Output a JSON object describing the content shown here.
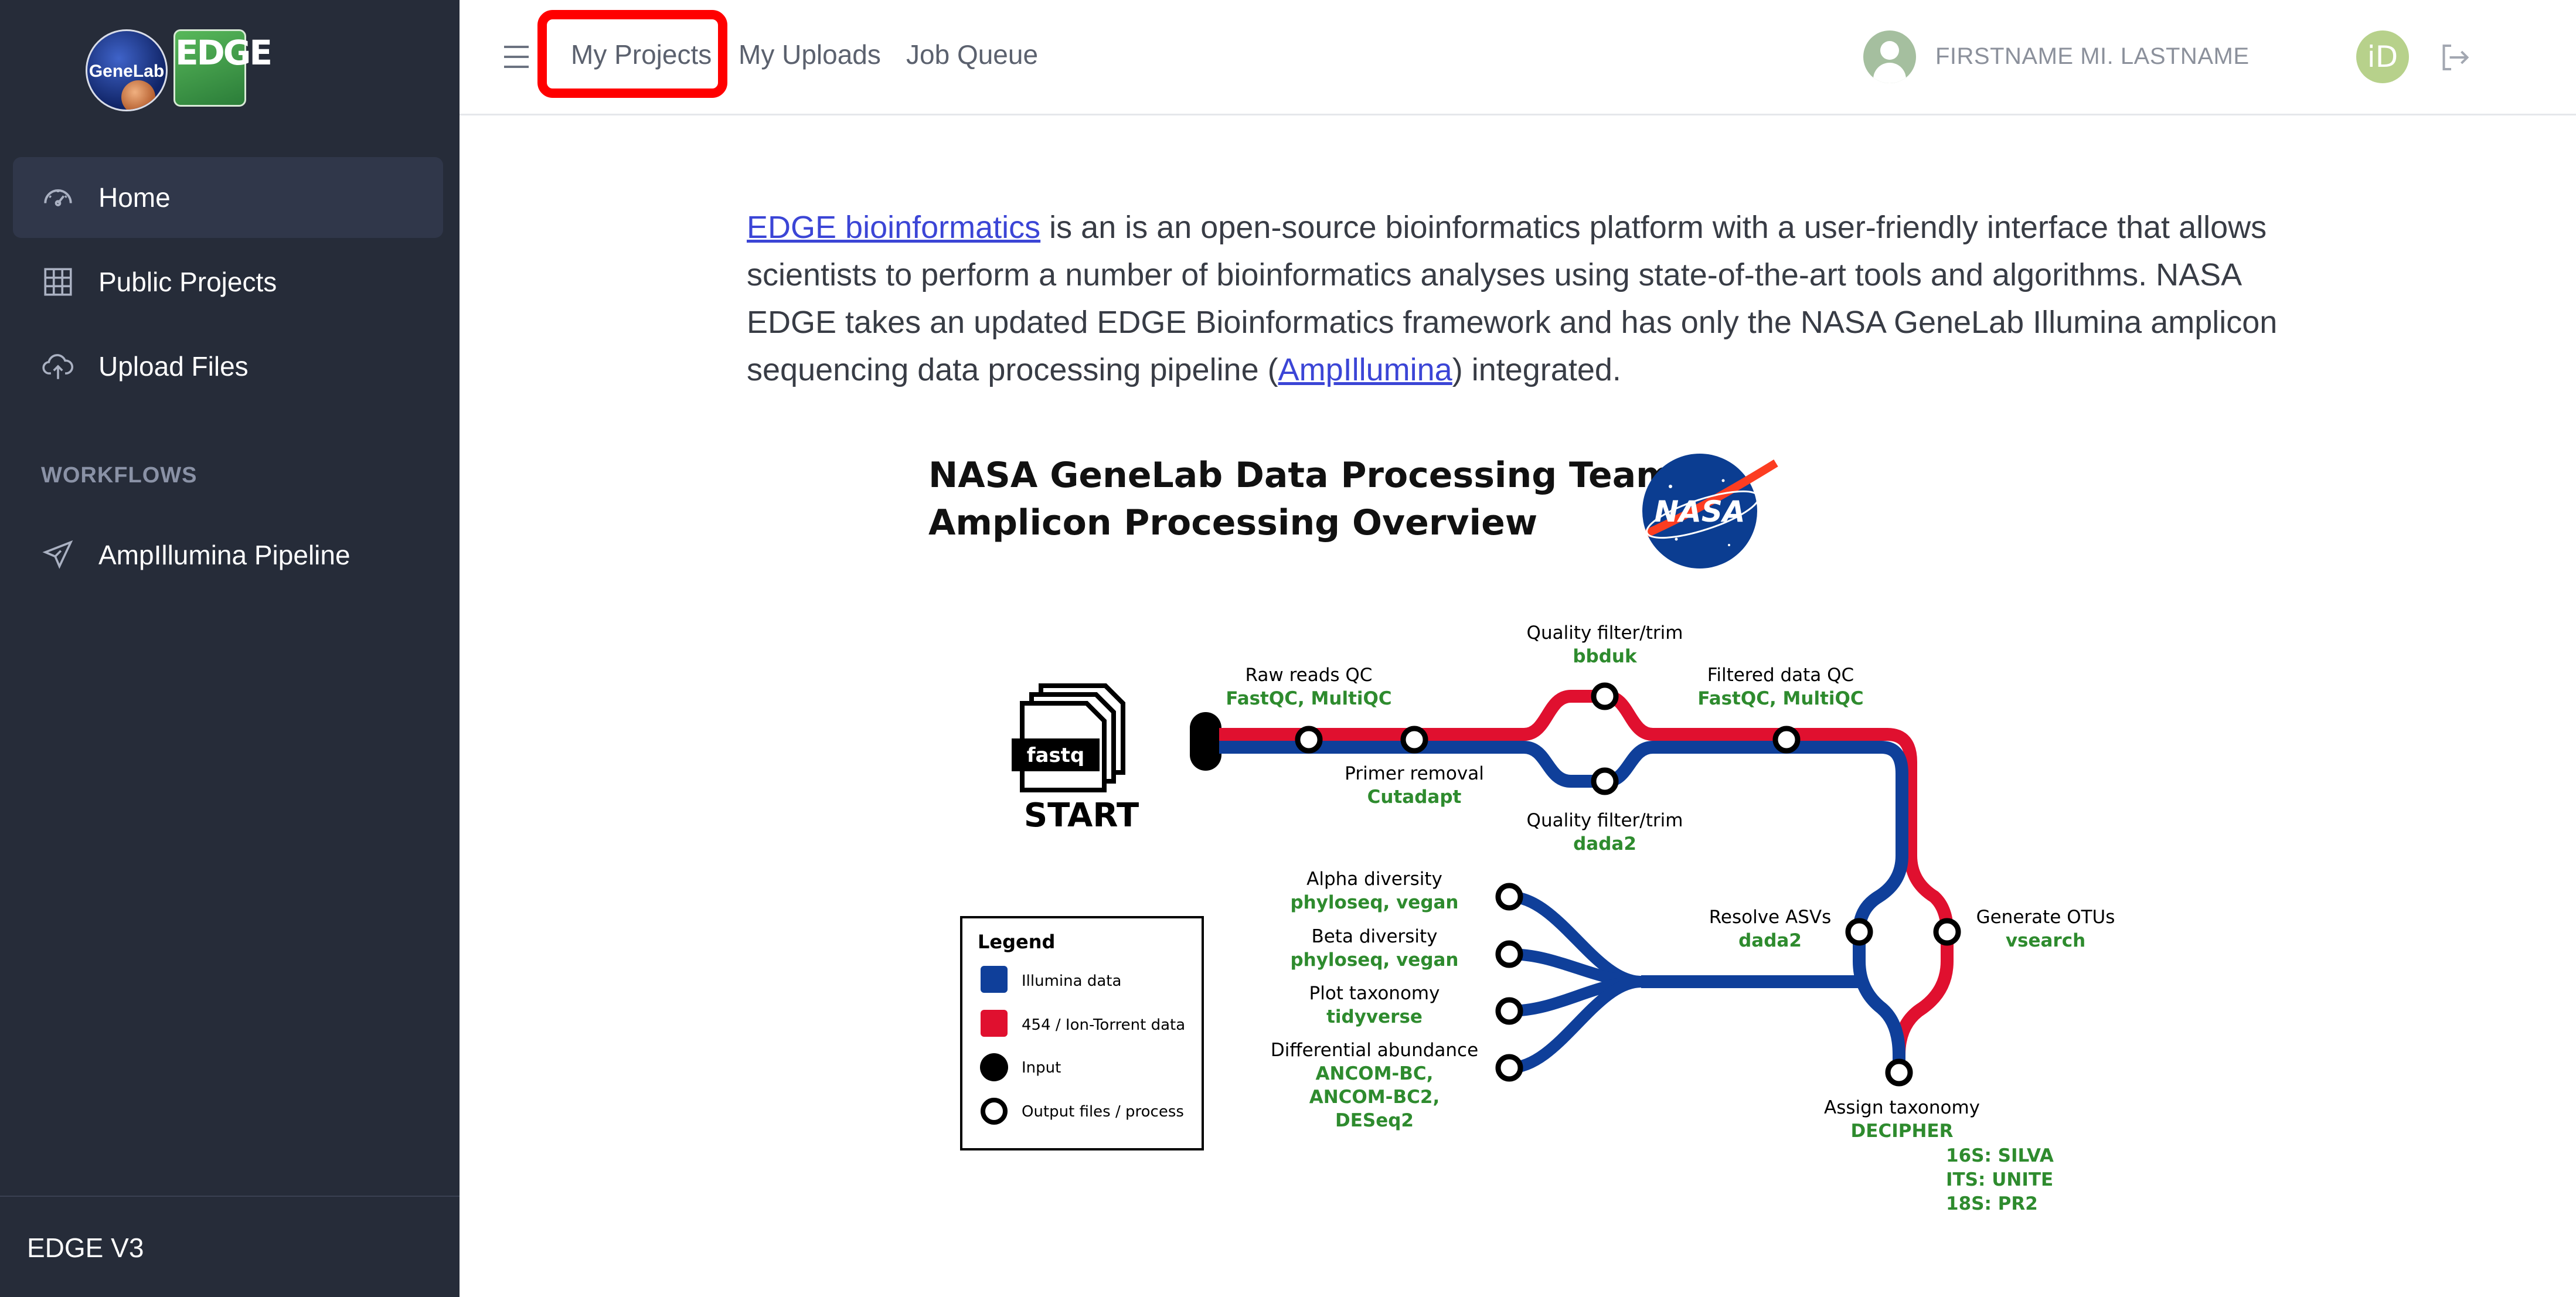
{
  "sidebar": {
    "logo_genelab_text": "GeneLab",
    "logo_edge_text": "EDGE",
    "items": [
      {
        "label": "Home",
        "icon": "dashboard-gauge-icon",
        "active": true
      },
      {
        "label": "Public Projects",
        "icon": "grid-table-icon",
        "active": false
      },
      {
        "label": "Upload Files",
        "icon": "cloud-upload-icon",
        "active": false
      }
    ],
    "workflows_title": "WORKFLOWS",
    "workflow_items": [
      {
        "label": "AmpIllumina Pipeline",
        "icon": "send-plane-icon"
      }
    ],
    "version": "EDGE V3"
  },
  "header": {
    "nav": [
      "My Projects",
      "My Uploads",
      "Job Queue"
    ],
    "highlighted": "My Projects",
    "user_name": "FIRSTNAME MI. LASTNAME",
    "orcid_label": "iD",
    "colors": {
      "highlight": "#ff0000",
      "avatar": "#a5bf9f",
      "orcid": "#b7d18b"
    }
  },
  "intro": {
    "link1": "EDGE bioinformatics",
    "text1": " is an is an open-source bioinformatics platform with a user-friendly interface that allows scientists to perform a number of bioinformatics analyses using state-of-the-art tools and algorithms. NASA EDGE takes an updated EDGE Bioinformatics framework and has only the NASA GeneLab Illumina amplicon sequencing data processing pipeline (",
    "link2": "AmpIllumina",
    "text2": ") integrated."
  },
  "diagram": {
    "title_line1": "NASA GeneLab Data Processing Team",
    "title_line2": "Amplicon Processing Overview",
    "nasa_logo_text": "NASA",
    "start_label": "START",
    "fastq_label": "fastq",
    "steps": {
      "raw_qc": {
        "name": "Raw reads QC",
        "tool": "FastQC, MultiQC"
      },
      "primer": {
        "name": "Primer removal",
        "tool": "Cutadapt"
      },
      "qf_top": {
        "name": "Quality filter/trim",
        "tool": "bbduk"
      },
      "qf_bottom": {
        "name": "Quality filter/trim",
        "tool": "dada2"
      },
      "filtered_qc": {
        "name": "Filtered data QC",
        "tool": "FastQC, MultiQC"
      },
      "resolve": {
        "name": "Resolve ASVs",
        "tool": "dada2"
      },
      "otus": {
        "name": "Generate OTUs",
        "tool": "vsearch"
      },
      "assign": {
        "name": "Assign taxonomy",
        "tool": "DECIPHER",
        "db1": "16S: SILVA",
        "db2": "ITS: UNITE",
        "db3": "18S: PR2"
      },
      "alpha": {
        "name": "Alpha diversity",
        "tool": "phyloseq, vegan"
      },
      "beta": {
        "name": "Beta diversity",
        "tool": "phyloseq, vegan"
      },
      "plot_tax": {
        "name": "Plot taxonomy",
        "tool": "tidyverse"
      },
      "diff": {
        "name": "Differential abundance",
        "tool1": "ANCOM-BC,",
        "tool2": "ANCOM-BC2,",
        "tool3": "DESeq2"
      }
    },
    "legend": {
      "title": "Legend",
      "illumina": "Illumina data",
      "ion": "454 / Ion-Torrent data",
      "input": "Input",
      "output": "Output files / process"
    },
    "colors": {
      "illumina": "#0f3f9a",
      "ion": "#e0102f",
      "tool_text": "#2e8b2e"
    }
  }
}
